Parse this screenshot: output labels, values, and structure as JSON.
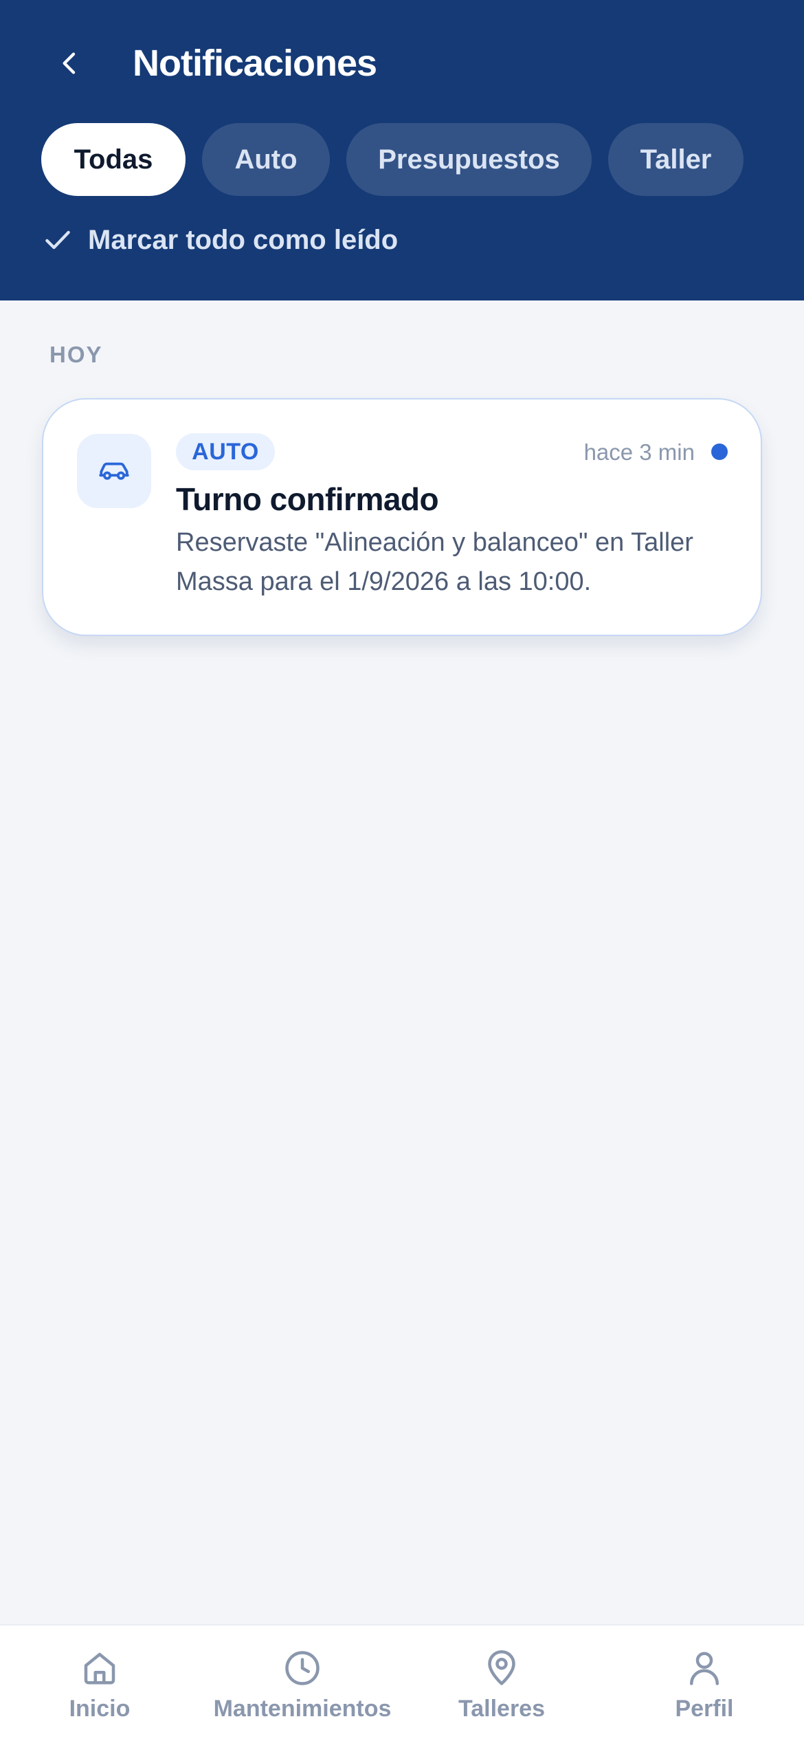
{
  "header": {
    "title": "Notificaciones",
    "back_icon": "chevron-left-icon",
    "filters": [
      {
        "label": "Todas",
        "active": true
      },
      {
        "label": "Auto",
        "active": false
      },
      {
        "label": "Presupuestos",
        "active": false
      },
      {
        "label": "Taller",
        "active": false
      }
    ],
    "mark_all_read": "Marcar todo como leído",
    "mark_all_read_icon": "check-icon",
    "background_color": "#153a76"
  },
  "sections": [
    {
      "label": "HOY",
      "notifications": [
        {
          "icon": "car-icon",
          "tag": "AUTO",
          "time": "hace 3 min",
          "unread": true,
          "title": "Turno confirmado",
          "body": "Reservaste \"Alineación y balanceo\" en Taller Massa para el 1/9/2026 a las 10:00."
        }
      ]
    }
  ],
  "bottom_nav": {
    "items": [
      {
        "label": "Inicio",
        "icon": "home-icon"
      },
      {
        "label": "Mantenimientos",
        "icon": "clock-icon"
      },
      {
        "label": "Talleres",
        "icon": "map-pin-icon"
      },
      {
        "label": "Perfil",
        "icon": "user-icon"
      }
    ]
  },
  "colors": {
    "accent": "#2a66d8",
    "muted": "#8a97ad",
    "page_background": "#f3f5f8"
  }
}
